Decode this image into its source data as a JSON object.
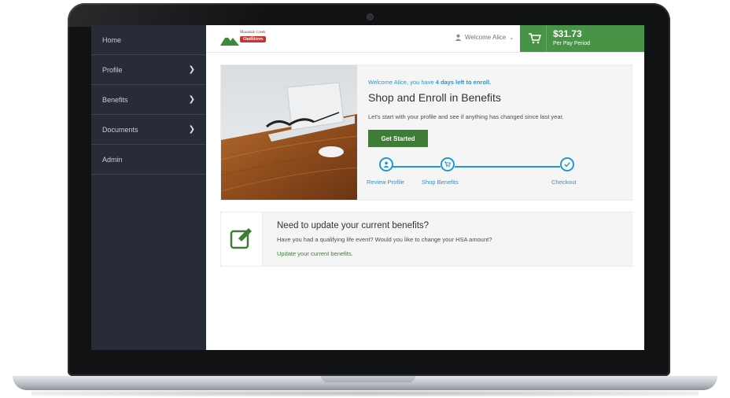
{
  "sidebar": {
    "items": [
      {
        "label": "Home",
        "chevron": false
      },
      {
        "label": "Profile",
        "chevron": true
      },
      {
        "label": "Benefits",
        "chevron": true
      },
      {
        "label": "Documents",
        "chevron": true
      },
      {
        "label": "Admin",
        "chevron": false
      }
    ]
  },
  "header": {
    "logo": {
      "line1": "Mountain Creek",
      "line2": "Outfitters"
    },
    "welcome": "Welcome Alice",
    "cart": {
      "amount": "$31.73",
      "period": "Per Pay Period"
    }
  },
  "hero": {
    "welcome_prefix": "Welcome Alice, you have ",
    "welcome_bold": "4 days left to enroll.",
    "title": "Shop and Enroll in Benefits",
    "subtitle": "Let's start with your profile and see if anything has changed since last year.",
    "button": "Get Started",
    "steps": [
      {
        "label": "Review Profile",
        "icon": "user-icon"
      },
      {
        "label": "Shop Benefits",
        "icon": "cart-icon"
      },
      {
        "label": "Checkout",
        "icon": "check-icon"
      }
    ]
  },
  "update": {
    "title": "Need to update your current benefits?",
    "subtitle": "Have you had a qualifying life event? Would you like to change your HSA amount?",
    "link": "Update your current benefits.",
    "icon": "edit-icon"
  },
  "colors": {
    "sidebar_bg": "#272c38",
    "accent_green": "#489447",
    "button_green": "#3d7d35",
    "accent_blue": "#1c9ad6"
  }
}
